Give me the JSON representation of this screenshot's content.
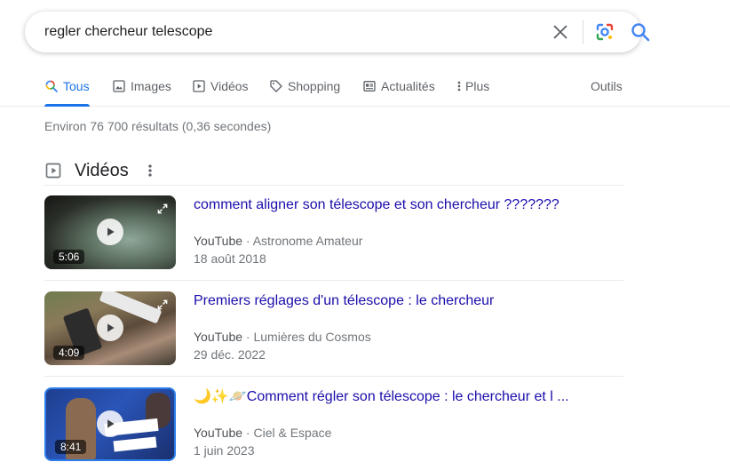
{
  "search": {
    "query": "regler chercheur telescope"
  },
  "tabs": [
    {
      "label": "Tous",
      "icon": "search-icon",
      "active": true
    },
    {
      "label": "Images",
      "icon": "image-icon"
    },
    {
      "label": "Vidéos",
      "icon": "play-icon"
    },
    {
      "label": "Shopping",
      "icon": "tag-icon"
    },
    {
      "label": "Actualités",
      "icon": "news-icon"
    },
    {
      "label": "Plus",
      "icon": "more-vert-icon"
    }
  ],
  "tools_label": "Outils",
  "result_stats": "Environ 76 700 résultats (0,36 secondes)",
  "videos_section": {
    "title": "Vidéos",
    "items": [
      {
        "title": "comment aligner son télescope et son chercheur ???????",
        "source": "YouTube",
        "separator": " · ",
        "channel": "Astronome Amateur",
        "date": "18 août 2018",
        "duration": "5:06"
      },
      {
        "title": "Premiers réglages d'un télescope : le chercheur",
        "source": "YouTube",
        "separator": " · ",
        "channel": "Lumières du Cosmos",
        "date": "29 déc. 2022",
        "duration": "4:09"
      },
      {
        "title": "🌙✨🪐Comment régler son télescope : le chercheur et l ...",
        "source": "YouTube",
        "separator": " · ",
        "channel": "Ciel & Espace",
        "date": "1 juin 2023",
        "duration": "8:41"
      }
    ]
  },
  "colors": {
    "link": "#1a0dab",
    "accent": "#1a73e8",
    "muted": "#70757a"
  }
}
